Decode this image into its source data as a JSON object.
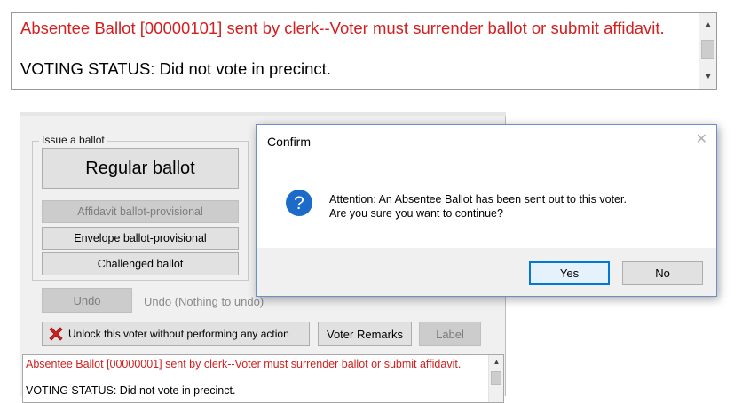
{
  "top_status": {
    "line1": "Absentee Ballot [00000101] sent by clerk--Voter must surrender ballot or submit affidavit.",
    "line2": "VOTING STATUS: Did not vote in precinct."
  },
  "issue_ballot": {
    "group_label": "Issue a ballot",
    "regular": "Regular ballot",
    "affidavit": "Affidavit ballot-provisional",
    "envelope": "Envelope ballot-provisional",
    "challenged": "Challenged ballot"
  },
  "undo": {
    "button": "Undo",
    "status": "Undo (Nothing to undo)"
  },
  "actions": {
    "unlock": "Unlock this voter without performing any action",
    "remarks": "Voter Remarks",
    "label": "Label"
  },
  "bottom_status": {
    "line1": "Absentee Ballot [00000001] sent by clerk--Voter must surrender ballot or submit affidavit.",
    "line2": "VOTING STATUS: Did not vote in precinct."
  },
  "dialog": {
    "title": "Confirm",
    "close": "✕",
    "message_line1": "Attention: An Absentee Ballot has been sent out to this voter.",
    "message_line2": "Are you sure you want to continue?",
    "yes": "Yes",
    "no": "No",
    "icon": "question-icon"
  },
  "colors": {
    "alert_red": "#d21f1f",
    "dialog_accent": "#0078d7",
    "question_blue": "#1c6bc9"
  }
}
